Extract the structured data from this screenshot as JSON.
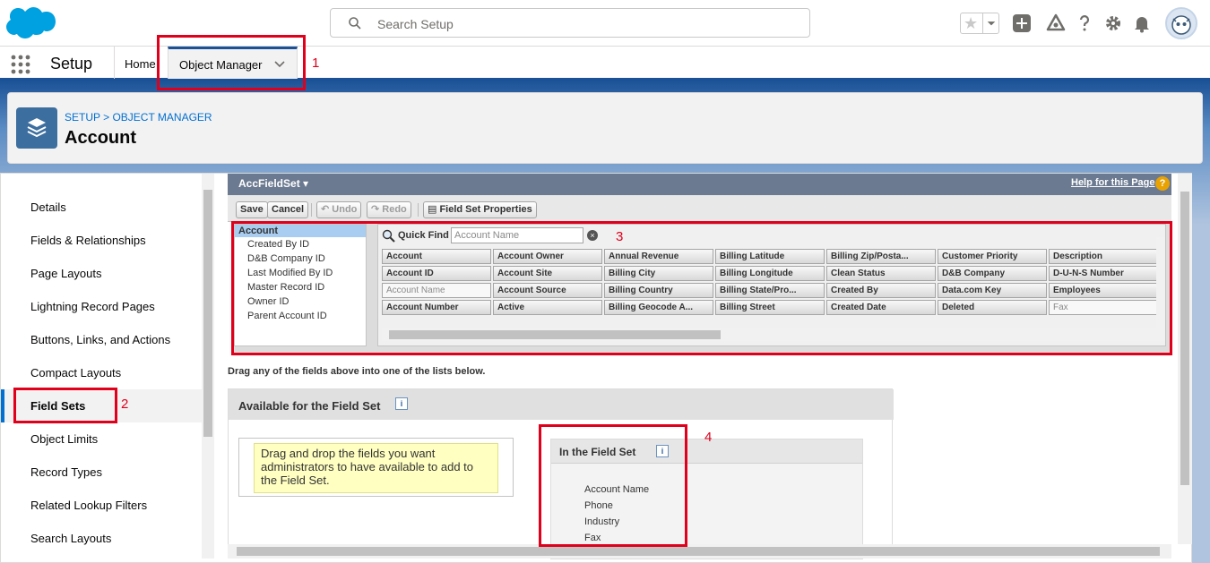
{
  "header": {
    "search_placeholder": "Search Setup",
    "icons": [
      "salesforce-logo",
      "search-icon",
      "favorites-star-icon",
      "add-icon",
      "trailhead-icon",
      "help-icon",
      "gear-icon",
      "bell-icon",
      "avatar"
    ]
  },
  "nav": {
    "app_name": "Setup",
    "home_label": "Home",
    "active_tab": "Object Manager"
  },
  "page_header": {
    "breadcrumb": "SETUP > OBJECT MANAGER",
    "title": "Account"
  },
  "sidebar": {
    "items": [
      {
        "label": "Details"
      },
      {
        "label": "Fields & Relationships"
      },
      {
        "label": "Page Layouts"
      },
      {
        "label": "Lightning Record Pages"
      },
      {
        "label": "Buttons, Links, and Actions"
      },
      {
        "label": "Compact Layouts"
      },
      {
        "label": "Field Sets"
      },
      {
        "label": "Object Limits"
      },
      {
        "label": "Record Types"
      },
      {
        "label": "Related Lookup Filters"
      },
      {
        "label": "Search Layouts"
      }
    ],
    "active_index": 6
  },
  "field_set": {
    "name": "AccFieldSet",
    "help_link": "Help for this Page",
    "toolbar": {
      "save": "Save",
      "cancel": "Cancel",
      "undo": "Undo",
      "redo": "Redo",
      "properties": "Field Set Properties"
    },
    "tree": {
      "root": "Account",
      "children": [
        "Created By ID",
        "D&B Company ID",
        "Last Modified By ID",
        "Master Record ID",
        "Owner ID",
        "Parent Account ID"
      ]
    },
    "quick_find": {
      "label": "Quick Find",
      "placeholder": "Account Name"
    },
    "grid": [
      [
        "Account",
        "Account Owner",
        "Annual Revenue",
        "Billing Latitude",
        "Billing Zip/Posta...",
        "Customer Priority",
        "Description"
      ],
      [
        "Account ID",
        "Account Site",
        "Billing City",
        "Billing Longitude",
        "Clean Status",
        "D&B Company",
        "D-U-N-S Number"
      ],
      [
        "Account Name",
        "Account Source",
        "Billing Country",
        "Billing State/Pro...",
        "Created By",
        "Data.com Key",
        "Employees"
      ],
      [
        "Account Number",
        "Active",
        "Billing Geocode A...",
        "Billing Street",
        "Created Date",
        "Deleted",
        "Fax"
      ]
    ],
    "used_fields": [
      "Account Name",
      "Fax"
    ],
    "drag_hint": "Drag any of the fields above into one of the lists below.",
    "available": {
      "title": "Available for the Field Set",
      "note": "Drag and drop the fields you want administrators to have available to add to the Field Set."
    },
    "in_set": {
      "title": "In the Field Set",
      "items": [
        "Account Name",
        "Phone",
        "Industry",
        "Fax"
      ]
    }
  },
  "annotations": [
    "1",
    "2",
    "3",
    "4"
  ],
  "colors": {
    "brand_blue": "#1b5297",
    "link_blue": "#0070d2",
    "annotation_red": "#e0001b"
  }
}
